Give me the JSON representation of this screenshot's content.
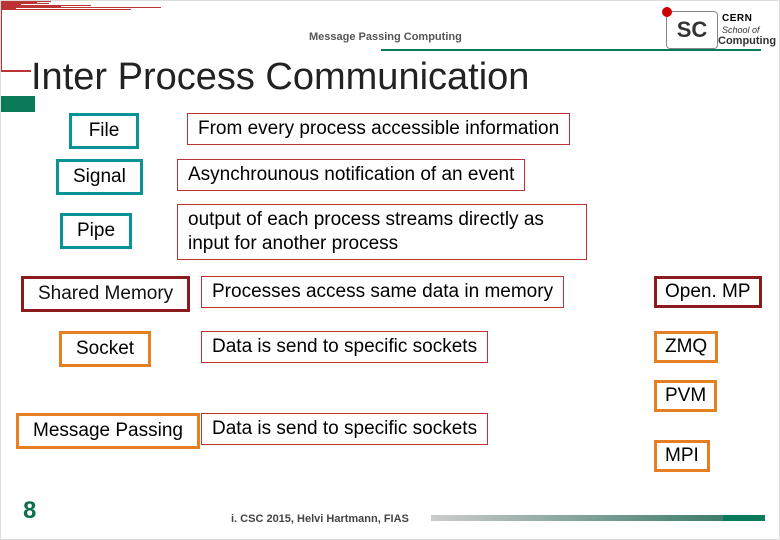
{
  "header": {
    "label": "Message Passing Computing"
  },
  "logo": {
    "big": "SC",
    "cern": "CERN",
    "school": "School of",
    "computing": "Computing"
  },
  "title": "Inter Process Communication",
  "rows": {
    "file": {
      "label": "File",
      "desc": "From every process accessible information"
    },
    "signal": {
      "label": "Signal",
      "desc": "Asynchrounous notification of an event"
    },
    "pipe": {
      "label": "Pipe",
      "desc": "output of each process streams directly as input for another process"
    },
    "shared": {
      "label": "Shared Memory",
      "desc": "Processes access same data in memory"
    },
    "socket": {
      "label": "Socket",
      "desc": "Data is send to specific sockets"
    },
    "msgpass": {
      "label": "Message Passing",
      "desc": "Data is send to specific sockets"
    }
  },
  "tags": {
    "openmp": "Open. MP",
    "zmq": "ZMQ",
    "pvm": "PVM",
    "mpi": "MPI"
  },
  "footer": {
    "page": "8",
    "credit": "i. CSC 2015, Helvi Hartmann, FIAS"
  }
}
